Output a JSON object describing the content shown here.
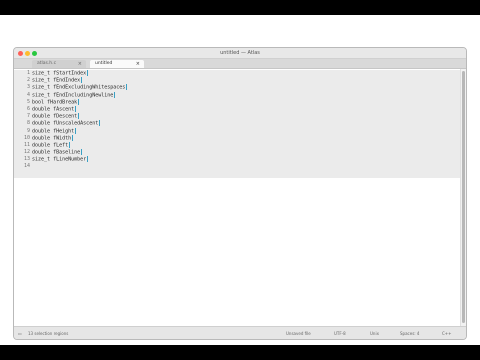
{
  "window": {
    "title": "untitled — Atlas"
  },
  "tabs": [
    {
      "label": "atlas.h.c",
      "active": false
    },
    {
      "label": "untitled",
      "active": true
    }
  ],
  "editor": {
    "line_numbers": [
      "1",
      "2",
      "3",
      "4",
      "5",
      "6",
      "7",
      "8",
      "9",
      "10",
      "11",
      "12",
      "13",
      "14"
    ],
    "lines": [
      "size_t fStartIndex",
      "size_t fEndIndex",
      "size_t fEndExcludingWhitespaces",
      "size_t fEndIncludingNewline",
      "bool fHardBreak",
      "double fAscent",
      "double fDescent",
      "double fUnscaledAscent",
      "double fHeight",
      "double fWidth",
      "double fLeft",
      "double fBaseline",
      "size_t fLineNumber",
      ""
    ]
  },
  "status": {
    "left": "13 selection regions",
    "unsaved": "Unsaved file",
    "encoding": "UTF-8",
    "line_endings": "Unix",
    "indent": "Spaces: 4",
    "syntax": "C++"
  },
  "colors": {
    "close": "#ff5f57",
    "minimize": "#febc2e",
    "zoom": "#28c840",
    "caret": "#3aa0c4"
  }
}
